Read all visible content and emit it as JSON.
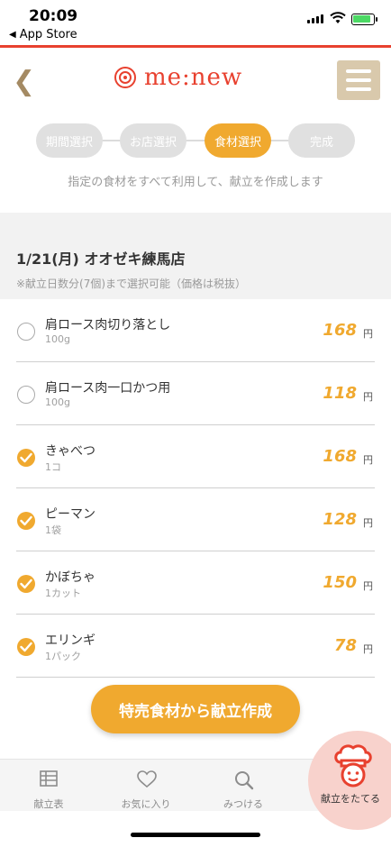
{
  "status_bar": {
    "time": "20:09",
    "back_app": "App Store"
  },
  "header": {
    "logo_text": "me:new"
  },
  "steps": [
    {
      "label": "期間選択",
      "active": false
    },
    {
      "label": "お店選択",
      "active": false
    },
    {
      "label": "食材選択",
      "active": true
    },
    {
      "label": "完成",
      "active": false
    }
  ],
  "instruction": "指定の食材をすべて利用して、献立を作成します",
  "store": {
    "title": "1/21(月) オオゼキ練馬店",
    "note": "※献立日数分(7個)まで選択可能（価格は税抜）"
  },
  "items": [
    {
      "name": "肩ロース肉切り落とし",
      "qty": "100g",
      "price": "168",
      "unit": "円",
      "checked": false
    },
    {
      "name": "肩ロース肉一口かつ用",
      "qty": "100g",
      "price": "118",
      "unit": "円",
      "checked": false
    },
    {
      "name": "きゃべつ",
      "qty": "1コ",
      "price": "168",
      "unit": "円",
      "checked": true
    },
    {
      "name": "ピーマン",
      "qty": "1袋",
      "price": "128",
      "unit": "円",
      "checked": true
    },
    {
      "name": "かぼちゃ",
      "qty": "1カット",
      "price": "150",
      "unit": "円",
      "checked": true
    },
    {
      "name": "エリンギ",
      "qty": "1パック",
      "price": "78",
      "unit": "円",
      "checked": true
    }
  ],
  "action_button": "特売食材から献立作成",
  "tabs": [
    {
      "label": "献立表",
      "icon": "table-icon"
    },
    {
      "label": "お気に入り",
      "icon": "heart-icon"
    },
    {
      "label": "みつける",
      "icon": "search-icon"
    },
    {
      "label": "献立をたてる",
      "icon": "chef-icon"
    }
  ],
  "colors": {
    "accent": "#f0a92f",
    "brand": "#e8412f",
    "menu": "#d9c9ac"
  }
}
